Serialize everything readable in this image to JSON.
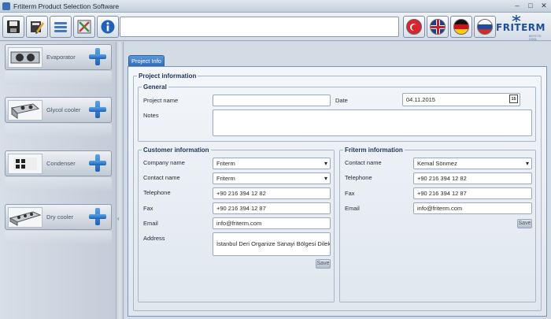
{
  "window": {
    "title": "Frtiterm Product Selection Software",
    "minimize": "–",
    "maximize": "□",
    "close": "✕"
  },
  "toolbar": {
    "buttons": [
      {
        "icon": "save-icon"
      },
      {
        "icon": "edit-icon"
      },
      {
        "icon": "list-icon"
      },
      {
        "icon": "tools-icon"
      },
      {
        "icon": "info-icon"
      }
    ],
    "field_value": "",
    "languages": [
      {
        "icon": "flag-turkey-icon",
        "color": "#d8242c"
      },
      {
        "icon": "flag-uk-icon",
        "color": "#1d3f8a"
      },
      {
        "icon": "flag-germany-icon",
        "color": "#ffcc00"
      },
      {
        "icon": "flag-russia-icon",
        "color": "#1c4ca3"
      }
    ],
    "logo_text": "FRITERM",
    "logo_tagline": "KEYS TO COOL"
  },
  "products": [
    {
      "label": "Evaporator"
    },
    {
      "label": "Glycol cooler"
    },
    {
      "label": "Condenser"
    },
    {
      "label": "Dry cooler"
    }
  ],
  "splitter_arrow": "‹",
  "tab": {
    "label": "Project Info"
  },
  "project": {
    "legend": "Project information",
    "general": {
      "legend": "General",
      "project_name_label": "Project name",
      "project_name_value": "",
      "date_label": "Date",
      "date_value": "04.11.2015",
      "calendar_day": "15",
      "notes_label": "Notes",
      "notes_value": ""
    },
    "customer": {
      "legend": "Customer information",
      "company_label": "Company name",
      "company_value": "Friterm",
      "contact_label": "Contact name",
      "contact_value": "Friterm",
      "telephone_label": "Telephone",
      "telephone_value": "+90 216 394 12 82",
      "fax_label": "Fax",
      "fax_value": "+90 216 394 12 87",
      "email_label": "Email",
      "email_value": "info@friterm.com",
      "address_label": "Address",
      "address_value": "İstanbul Deri Organize Sanayi Bölgesi Dilek Sc",
      "save_label": "Save"
    },
    "friterm": {
      "legend": "Friterm information",
      "contact_label": "Contact name",
      "contact_value": "Kemal Sönmez",
      "telephone_label": "Telephone",
      "telephone_value": "+90 216 394 12 82",
      "fax_label": "Fax",
      "fax_value": "+90 216 394 12 87",
      "email_label": "Email",
      "email_value": "info@friterm.com",
      "save_label": "Save"
    }
  }
}
